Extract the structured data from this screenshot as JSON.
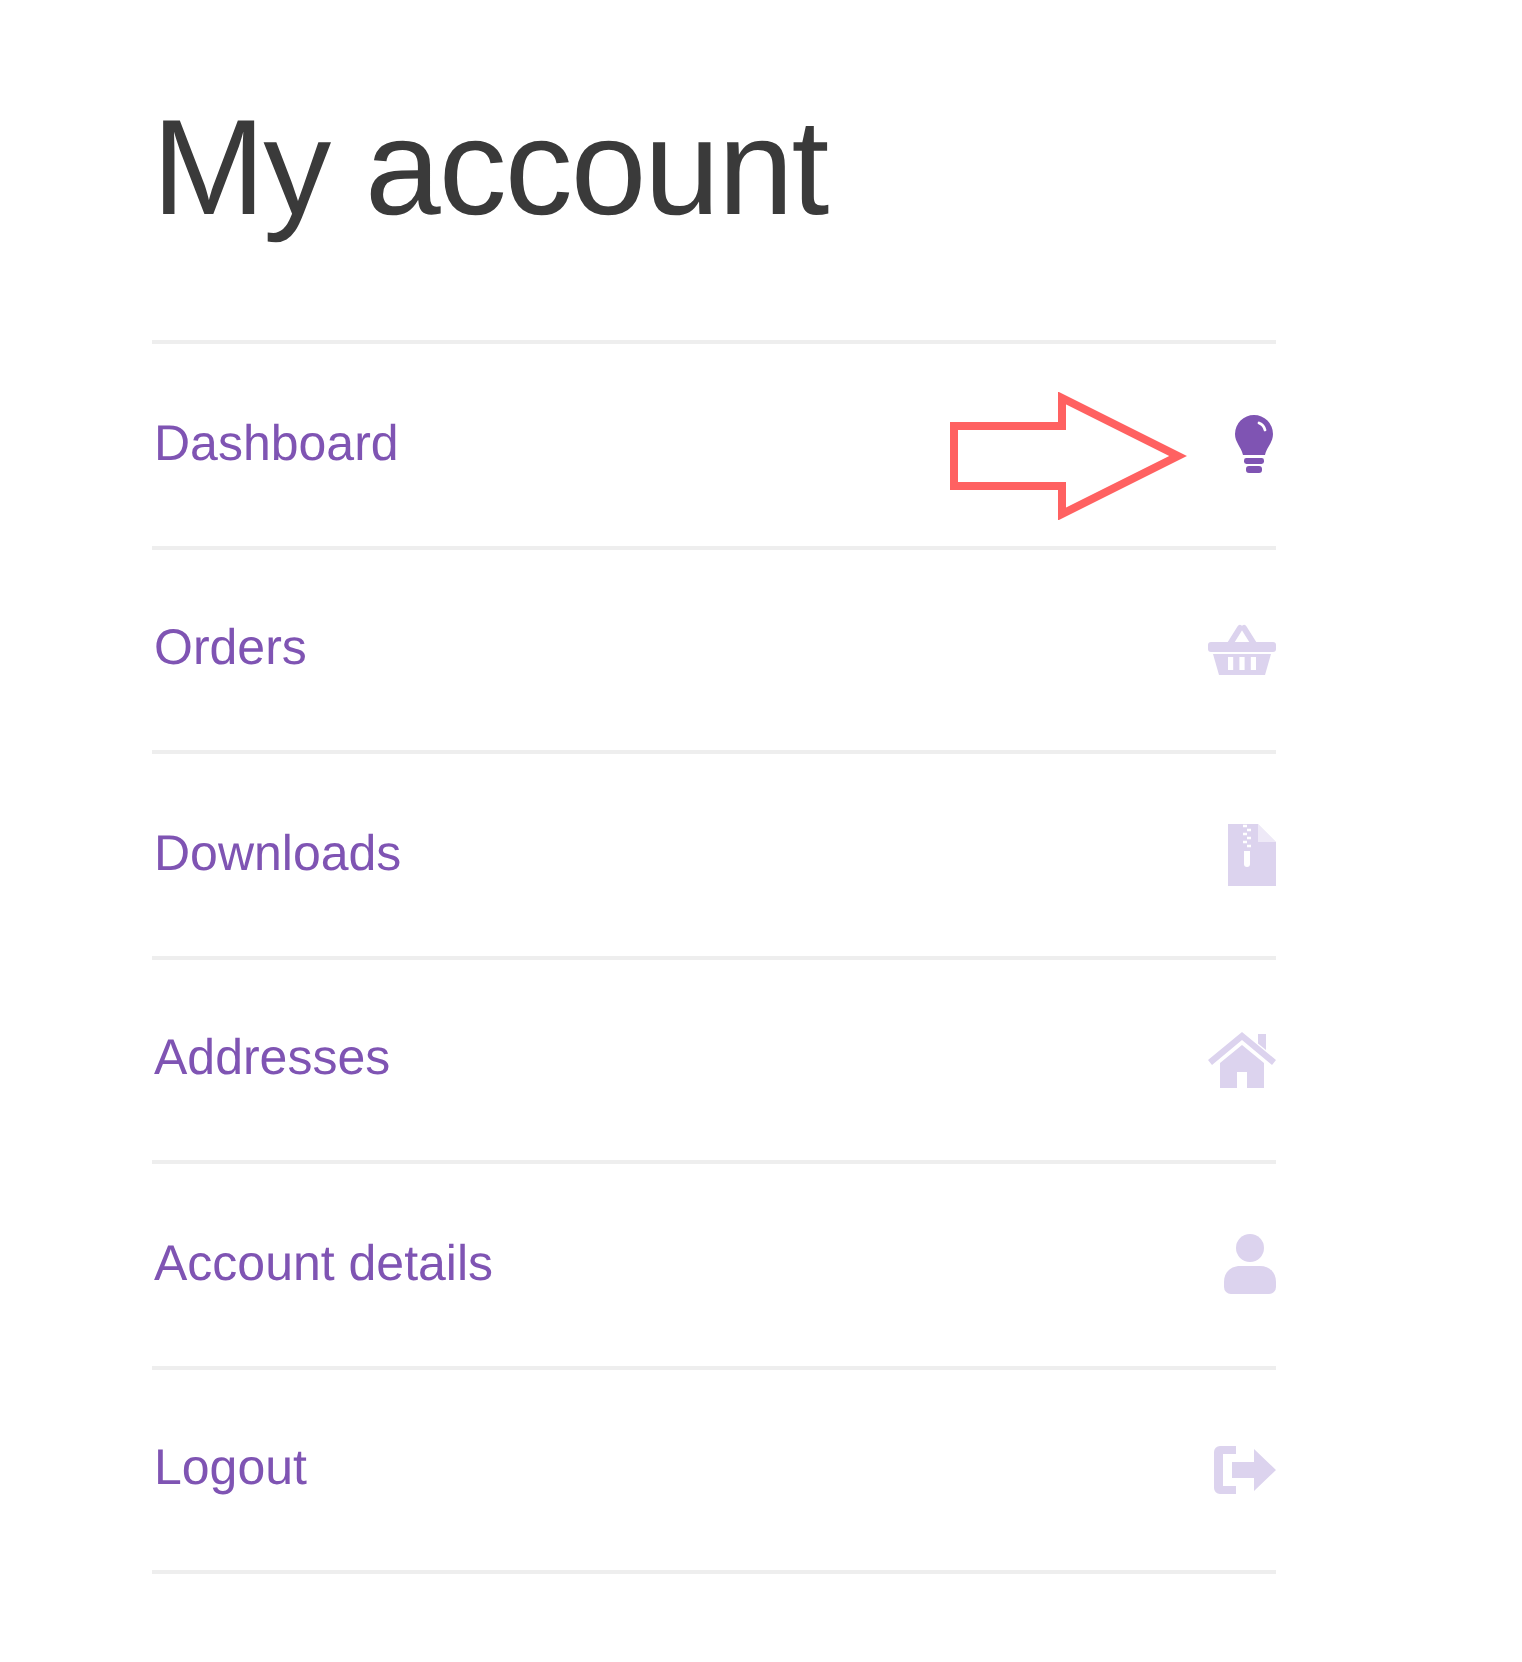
{
  "page": {
    "title": "My account"
  },
  "nav": {
    "items": [
      {
        "label": "Dashboard",
        "kind": "bulb",
        "selected": true,
        "annotated": true
      },
      {
        "label": "Orders",
        "kind": "basket",
        "selected": false,
        "annotated": false
      },
      {
        "label": "Downloads",
        "kind": "zip",
        "selected": false,
        "annotated": false
      },
      {
        "label": "Addresses",
        "kind": "home",
        "selected": false,
        "annotated": false
      },
      {
        "label": "Account details",
        "kind": "user",
        "selected": false,
        "annotated": false
      },
      {
        "label": "Logout",
        "kind": "logout",
        "selected": false,
        "annotated": false
      }
    ]
  }
}
